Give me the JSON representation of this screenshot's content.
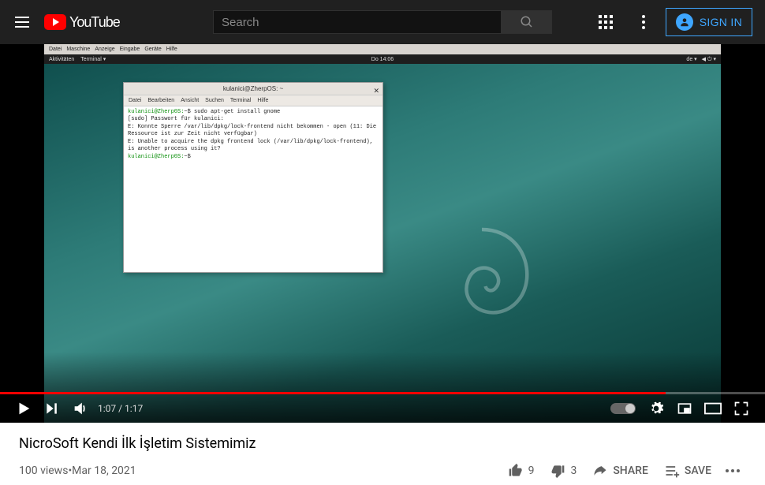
{
  "header": {
    "logo_text": "YouTube",
    "search_placeholder": "Search",
    "signin_label": "SIGN IN"
  },
  "player": {
    "current_time": "1:07",
    "duration": "1:17",
    "vmenu": [
      "Datei",
      "Maschine",
      "Anzeige",
      "Eingabe",
      "Geräte",
      "Hilfe"
    ],
    "desk_left": "Aktivitäten",
    "desk_app": "Terminal ▾",
    "desk_clock": "Do 14:06",
    "desk_lang": "de ▾"
  },
  "terminal": {
    "title": "kulanici@ZherpOS: ~",
    "menu": [
      "Datei",
      "Bearbeiten",
      "Ansicht",
      "Suchen",
      "Terminal",
      "Hilfe"
    ],
    "prompt1": "kulanici@Zherp0S:",
    "line1": "~$ sudo apt-get install gnome",
    "line2": "[sudo] Passwort für kulanici:",
    "line3": "E: Konnte Sperre /var/lib/dpkg/lock-frontend nicht bekommen - open (11: Die Ressource ist zur Zeit nicht verfügbar)",
    "line4": "E: Unable to acquire the dpkg frontend lock (/var/lib/dpkg/lock-frontend), is another process using it?",
    "prompt2": "kulanici@Zherp0S:",
    "line5": "~$"
  },
  "video": {
    "title": "NicroSoft Kendi İlk İşletim Sistemimiz",
    "views": "100 views",
    "sep": " • ",
    "date": "Mar 18, 2021",
    "likes": "9",
    "dislikes": "3",
    "share": "SHARE",
    "save": "SAVE"
  }
}
